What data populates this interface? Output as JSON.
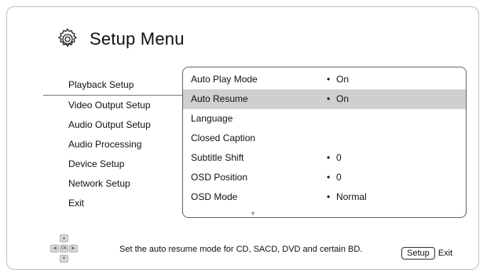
{
  "header": {
    "title": "Setup Menu",
    "icon": "gear-icon"
  },
  "left_menu": {
    "items": [
      {
        "label": "Playback Setup",
        "active": true
      },
      {
        "label": "Video Output Setup",
        "active": false
      },
      {
        "label": "Audio Output Setup",
        "active": false
      },
      {
        "label": "Audio Processing",
        "active": false
      },
      {
        "label": "Device Setup",
        "active": false
      },
      {
        "label": "Network Setup",
        "active": false
      },
      {
        "label": "Exit",
        "active": false
      }
    ]
  },
  "settings": {
    "rows": [
      {
        "label": "Auto Play Mode",
        "bullet": "•",
        "value": "On",
        "selected": false
      },
      {
        "label": "Auto Resume",
        "bullet": "•",
        "value": "On",
        "selected": true
      },
      {
        "label": "Language",
        "bullet": "",
        "value": "",
        "selected": false
      },
      {
        "label": "Closed Caption",
        "bullet": "",
        "value": "",
        "selected": false
      },
      {
        "label": "Subtitle Shift",
        "bullet": "•",
        "value": "0",
        "selected": false
      },
      {
        "label": "OSD Position",
        "bullet": "•",
        "value": "0",
        "selected": false
      },
      {
        "label": "OSD Mode",
        "bullet": "•",
        "value": "Normal",
        "selected": false
      }
    ],
    "scroll_down_icon": "triangle-down-icon"
  },
  "footer": {
    "help_text": "Set the auto resume mode for CD, SACD, DVD and certain BD.",
    "dpad_ok_label": "OK",
    "setup_button_label": "Setup",
    "exit_label": "Exit"
  },
  "colors": {
    "selected_row_bg": "#cfcfcf",
    "border": "#666666"
  }
}
